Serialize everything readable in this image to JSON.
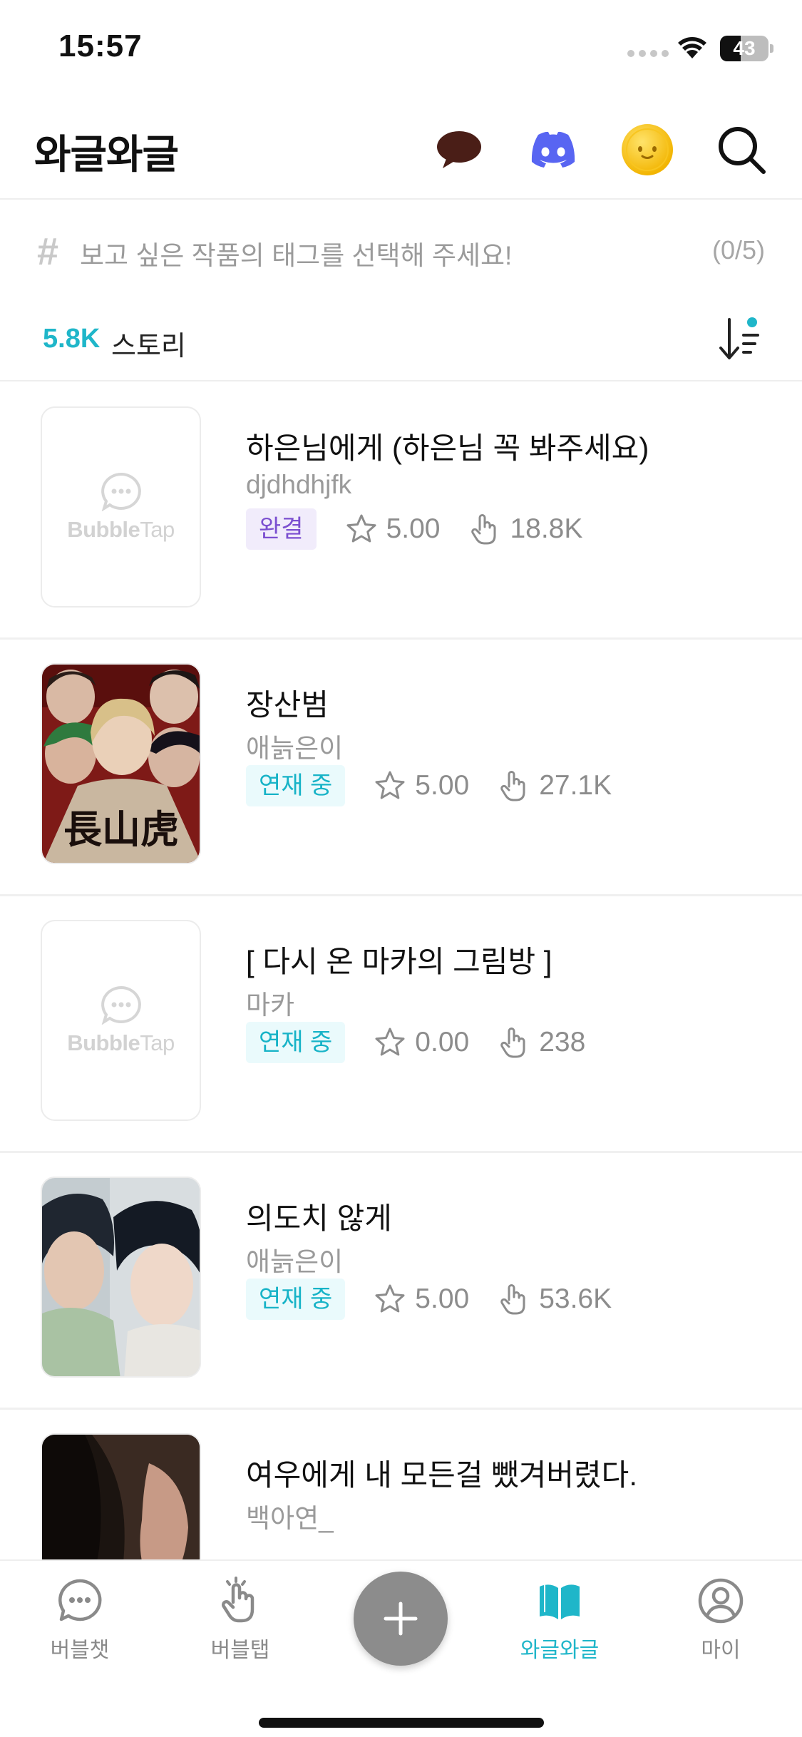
{
  "status_bar": {
    "time": "15:57",
    "battery_level": "43",
    "battery_fraction": 0.43
  },
  "header": {
    "title": "와글와글",
    "actions": [
      "chat-bubble-icon",
      "discord-icon",
      "emoji-coin-icon",
      "search-icon"
    ]
  },
  "tag_filter": {
    "placeholder": "보고 싶은 작품의 태그를 선택해 주세요!",
    "count": "(0/5)"
  },
  "story_count": {
    "value": "5.8K",
    "label": "스토리"
  },
  "stories": [
    {
      "title": "하은님에게 (하은님 꼭 봐주세요)",
      "author": "djdhdhjfk",
      "status": "완결",
      "rating": "5.00",
      "views": "18.8K",
      "thumbnail": "placeholder"
    },
    {
      "title": "장산범",
      "author": "애늙은이",
      "status": "연재 중",
      "rating": "5.00",
      "views": "27.1K",
      "thumbnail": "art"
    },
    {
      "title": "[ 다시 온 마카의 그림방 ]",
      "author": "마카",
      "status": "연재 중",
      "rating": "0.00",
      "views": "238",
      "thumbnail": "placeholder"
    },
    {
      "title": "의도치 않게",
      "author": "애늙은이",
      "status": "연재 중",
      "rating": "5.00",
      "views": "53.6K",
      "thumbnail": "art"
    },
    {
      "title": "여우에게 내 모든걸 뺐겨버렸다.",
      "author": "백아연_",
      "status": "",
      "rating": "",
      "views": "",
      "thumbnail": "art"
    }
  ],
  "placeholder_logo": {
    "bold": "Bubble",
    "light": "Tap"
  },
  "bottom_nav": {
    "items": [
      {
        "label": "버블챗",
        "icon": "chat-icon"
      },
      {
        "label": "버블탭",
        "icon": "tap-hand-icon"
      },
      {
        "label": "와글와글",
        "icon": "book-icon",
        "active": true
      },
      {
        "label": "마이",
        "icon": "profile-icon"
      }
    ],
    "fab_icon": "plus-icon"
  },
  "colors": {
    "accent": "#1fb6c9",
    "done_badge": "#7b4fd0"
  }
}
